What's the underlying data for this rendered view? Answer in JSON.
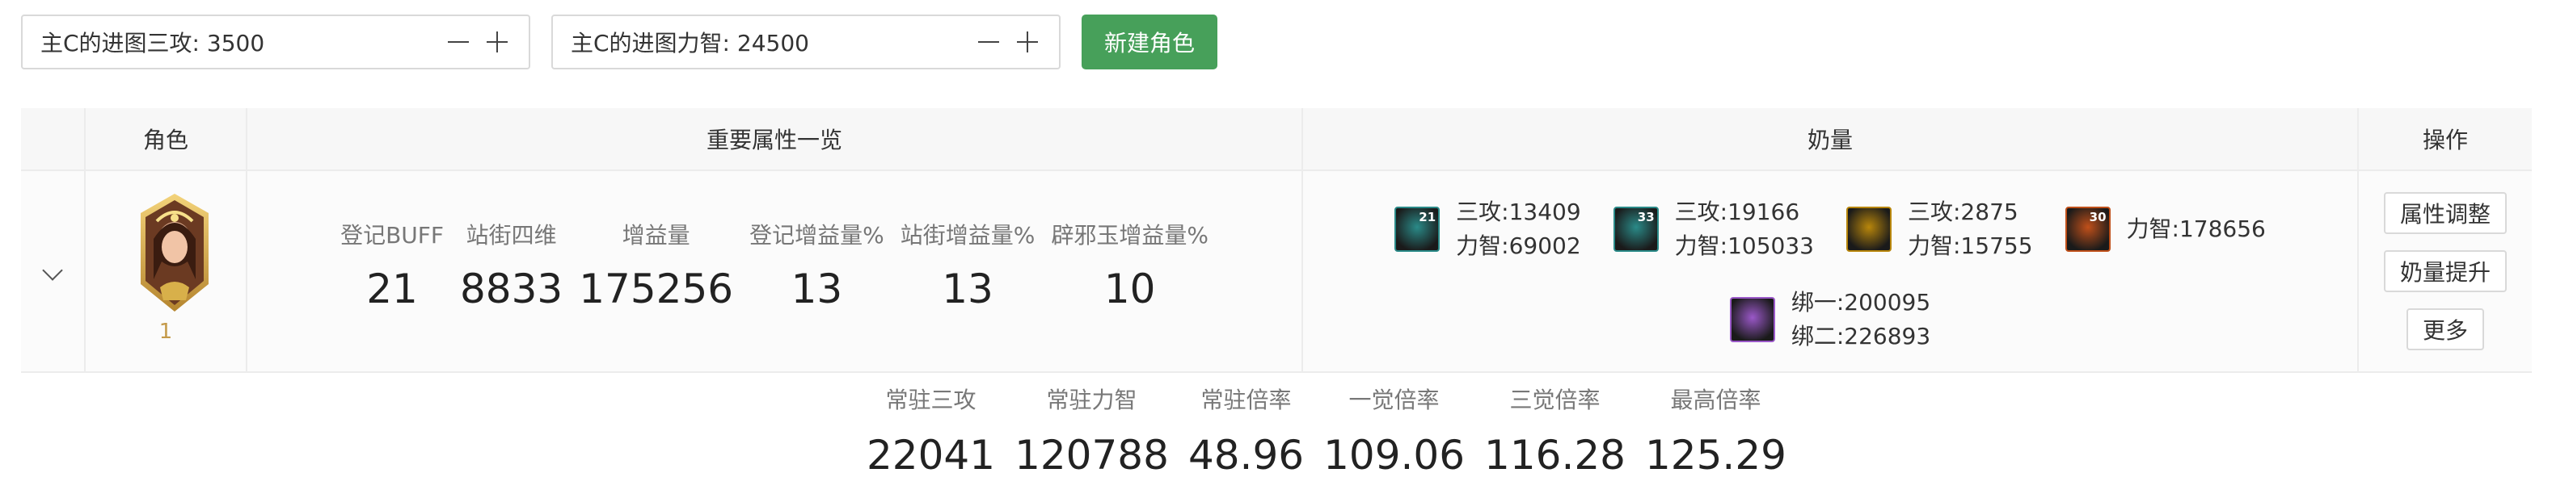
{
  "topbar": {
    "sanGong": {
      "label": "主C的进图三攻: 3500"
    },
    "liZhi": {
      "label": "主C的进图力智: 24500"
    },
    "new_button": "新建角色"
  },
  "table": {
    "headers": {
      "role": "角色",
      "attrs": "重要属性一览",
      "nai": "奶量",
      "ops": "操作"
    },
    "row": {
      "avatar_number": "1",
      "stats": [
        {
          "k": "登记BUFF",
          "v": "21"
        },
        {
          "k": "站街四维",
          "v": "8833"
        },
        {
          "k": "增益量",
          "v": "175256"
        },
        {
          "k": "登记增益量%",
          "v": "13"
        },
        {
          "k": "站街增益量%",
          "v": "13"
        },
        {
          "k": "辟邪玉增益量%",
          "v": "10"
        }
      ],
      "nai": [
        {
          "icon": "buff-skill-icon",
          "level": "21",
          "l1": "三攻:13409",
          "l2": "力智:69002",
          "color": "#2a8a88"
        },
        {
          "icon": "buff-skill-icon",
          "level": "33",
          "l1": "三攻:19166",
          "l2": "力智:105033",
          "color": "#2a8a88"
        },
        {
          "icon": "aura-skill-icon",
          "level": "",
          "l1": "三攻:2875",
          "l2": "力智:15755",
          "color": "#b8860b"
        },
        {
          "icon": "awaken-skill-icon",
          "level": "30",
          "l1": "力智:178656",
          "l2": "",
          "color": "#c0501a"
        },
        {
          "icon": "bind-skill-icon",
          "level": "",
          "l1": "绑一:200095",
          "l2": "绑二:226893",
          "color": "#9a58c8"
        }
      ],
      "ops": [
        "属性调整",
        "奶量提升",
        "更多"
      ]
    }
  },
  "summary": [
    {
      "k": "常驻三攻",
      "v": "22041"
    },
    {
      "k": "常驻力智",
      "v": "120788"
    },
    {
      "k": "常驻倍率",
      "v": "48.96"
    },
    {
      "k": "一觉倍率",
      "v": "109.06"
    },
    {
      "k": "三觉倍率",
      "v": "116.28"
    },
    {
      "k": "最高倍率",
      "v": "125.29"
    }
  ]
}
